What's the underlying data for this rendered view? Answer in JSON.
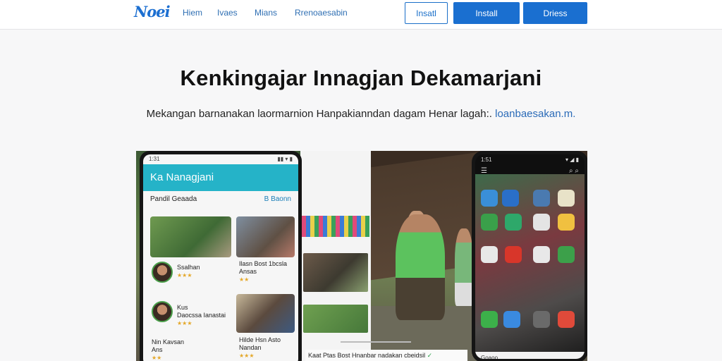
{
  "header": {
    "logo": "Noei",
    "nav": [
      "Hiem",
      "Ivaes",
      "Mians",
      "Rrenoaesabin"
    ],
    "buttons": {
      "outline": "Insatl",
      "primary": "Install",
      "secondary": "Driess"
    }
  },
  "hero": {
    "title": "Kenkingajar Innagjan Dekamarjani",
    "subtitle": "Mekangan barnanakan laormarnion  Hanpakianndan dagam Henar lagah:.",
    "subtitle_link": "loanbaesakan.",
    "subtitle_end": "m."
  },
  "left_phone": {
    "status_time": "1:31",
    "status_icons": "▮▮ ▾ ▮",
    "app_title": "Ka Nanagjani",
    "section_title": "Pandil Geaada",
    "section_more": "B Baonn",
    "card1_name": "Ssalhan",
    "card1_stars": "★★★",
    "card2_title": "Ilasn Bost 1bcsla",
    "card2_sub": "Ansas",
    "card2_stars": "★★",
    "card3_name": "Kus",
    "card3_sub": "Daocssa Ianastai",
    "card3_stars": "★★★",
    "card4_title": "Hilde Hsn Asto",
    "card4_sub": "Nandan",
    "card4_stars": "★★★",
    "card5_name": "Nin Kavsan",
    "card5_sub": "Ans",
    "card5_stars": "★★"
  },
  "right_phone": {
    "status_time": "1:51",
    "status_icons": "▾ ◢ ▮",
    "toolbar_left": "☰",
    "toolbar_right": "⌕ ⌕",
    "sheet_text": "Goaoo"
  },
  "caption": {
    "text": "Kaat Ptas Bost Hnanbar nadakan cbeidsil",
    "check": "✓"
  },
  "colors": {
    "accent": "#1a6fd0",
    "app_header": "#25b3c8",
    "rating": "#e4a82a"
  }
}
